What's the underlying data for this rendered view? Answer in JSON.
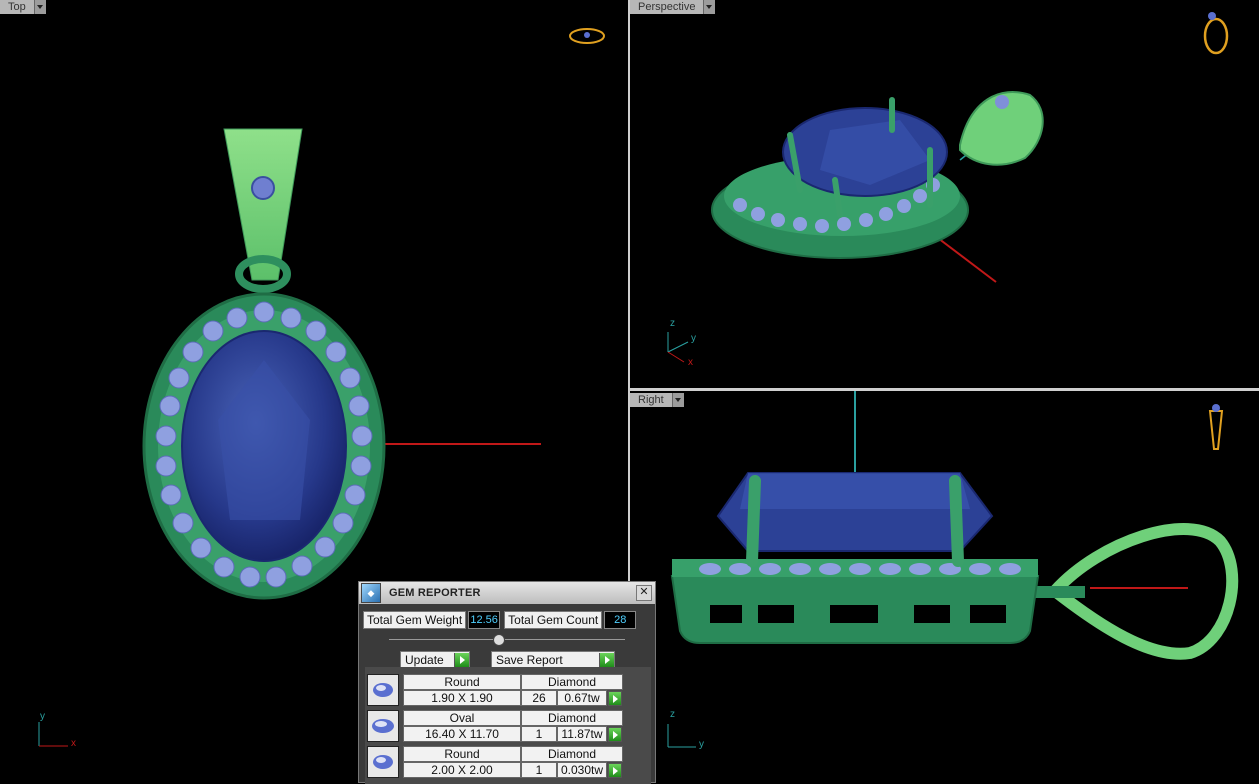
{
  "viewports": {
    "top": {
      "label": "Top"
    },
    "perspective": {
      "label": "Perspective"
    },
    "right": {
      "label": "Right"
    }
  },
  "axes": {
    "x": "x",
    "y": "y",
    "z": "z"
  },
  "colors": {
    "metal": "#2f9a62",
    "metal_light": "#7fd97a",
    "gem": "#2a3f8f",
    "accent_gem": "#7f8fd8",
    "axis_x": "#c01818",
    "axis_y": "#2aa0a0"
  },
  "gem_reporter": {
    "title": "GEM REPORTER",
    "total_weight_label": "Total Gem Weight",
    "total_weight": "12.56",
    "total_count_label": "Total Gem Count",
    "total_count": "28",
    "update_label": "Update",
    "save_report_label": "Save Report",
    "rows": [
      {
        "shape": "Round",
        "material": "Diamond",
        "size": "1.90 X 1.90",
        "count": "26",
        "weight": "0.67tw"
      },
      {
        "shape": "Oval",
        "material": "Diamond",
        "size": "16.40 X 11.70",
        "count": "1",
        "weight": "11.87tw"
      },
      {
        "shape": "Round",
        "material": "Diamond",
        "size": "2.00 X 2.00",
        "count": "1",
        "weight": "0.030tw"
      }
    ]
  }
}
